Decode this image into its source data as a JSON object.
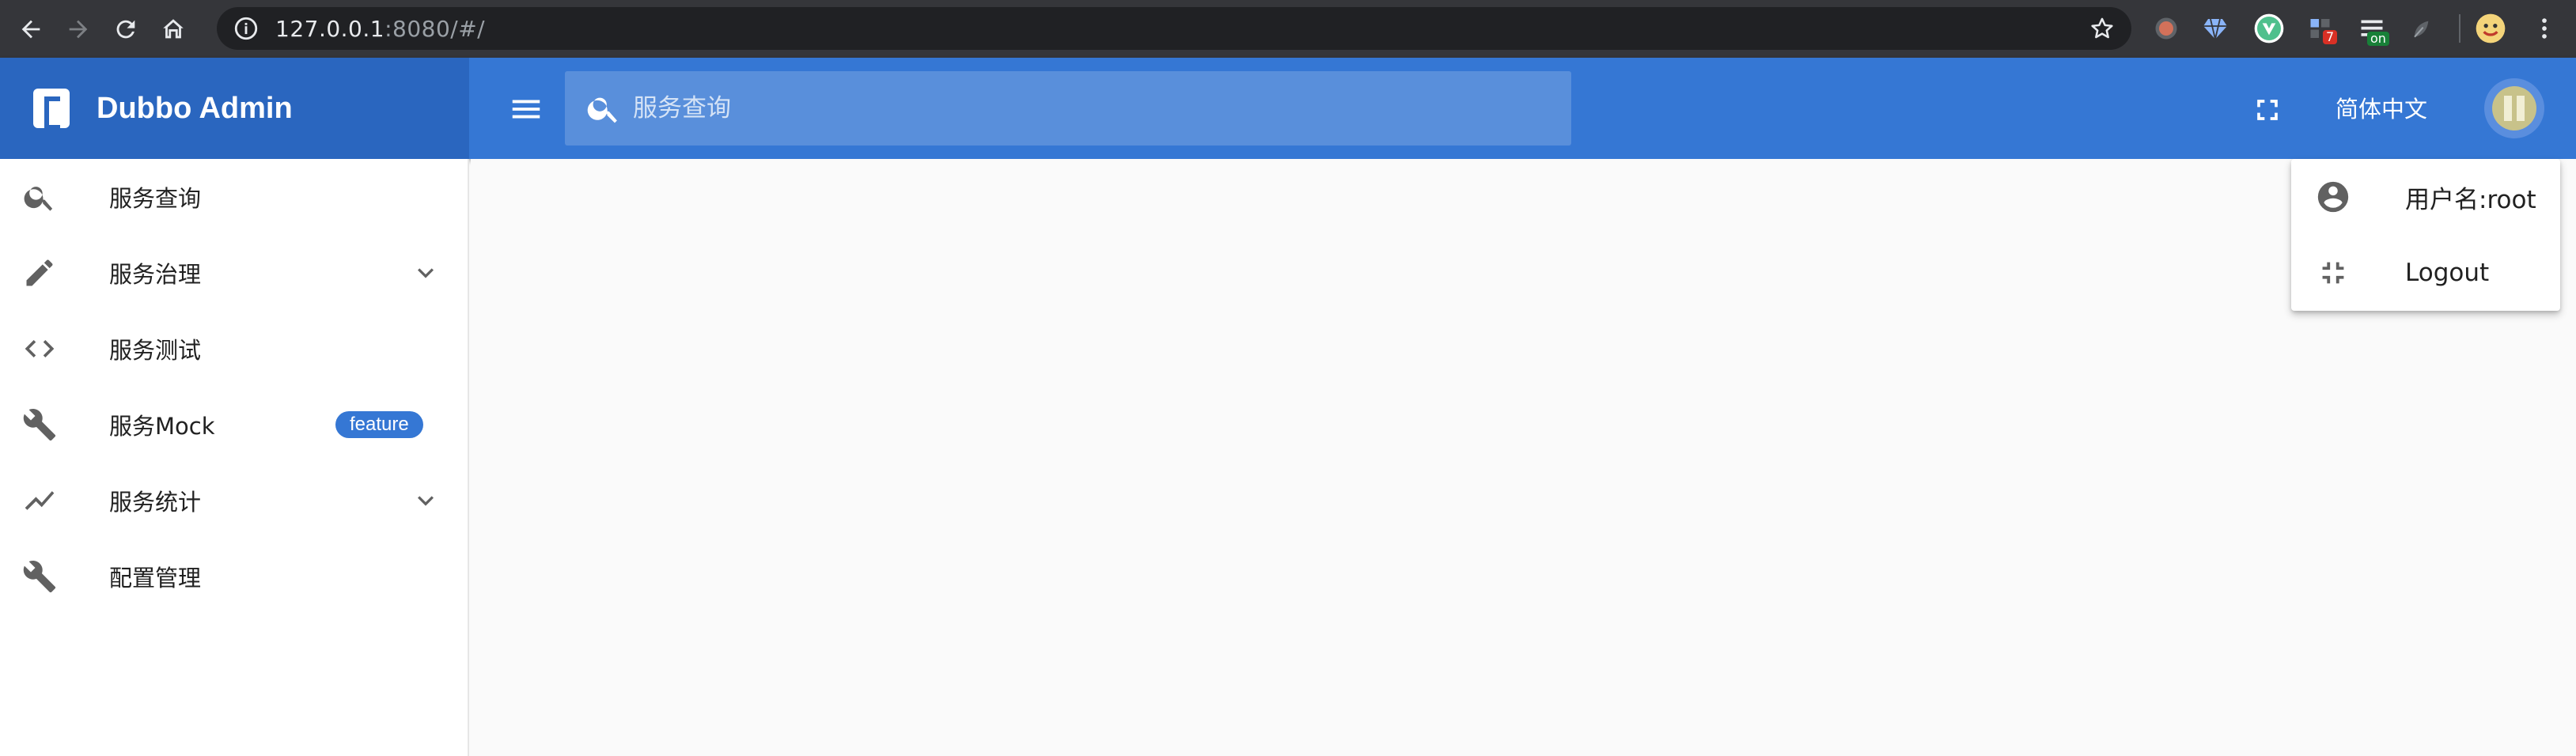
{
  "browser": {
    "url_host": "127.0.0.1",
    "url_rest": ":8080/#/",
    "extensions": [
      {
        "icon": "record-extension-icon",
        "color": "#d2715a"
      },
      {
        "icon": "diamond-extension-icon",
        "color": "#8ab4f8"
      },
      {
        "icon": "vue-devtools-icon",
        "color": "#4fc08d"
      },
      {
        "icon": "grid-extension-icon",
        "badge": "7",
        "badge_color": "#d93025"
      },
      {
        "icon": "list-extension-icon",
        "badge": "on",
        "badge_color": "#188038"
      },
      {
        "icon": "leaf-extension-icon"
      },
      {
        "icon": "profile-avatar-icon"
      }
    ]
  },
  "app": {
    "title": "Dubbo Admin",
    "search_placeholder": "服务查询",
    "language": "简体中文",
    "colors": {
      "primary": "#3577d4",
      "brand_bg": "#2a66bf"
    }
  },
  "sidebar": {
    "items": [
      {
        "label": "服务查询",
        "icon": "search-icon",
        "expandable": false
      },
      {
        "label": "服务治理",
        "icon": "pencil-icon",
        "expandable": true
      },
      {
        "label": "服务测试",
        "icon": "code-icon",
        "expandable": false
      },
      {
        "label": "服务Mock",
        "icon": "wrench-icon",
        "badge": "feature"
      },
      {
        "label": "服务统计",
        "icon": "trending-icon",
        "expandable": true
      },
      {
        "label": "配置管理",
        "icon": "wrench-icon",
        "expandable": false
      }
    ]
  },
  "user_menu": {
    "username": "用户名:root",
    "logout": "Logout"
  }
}
